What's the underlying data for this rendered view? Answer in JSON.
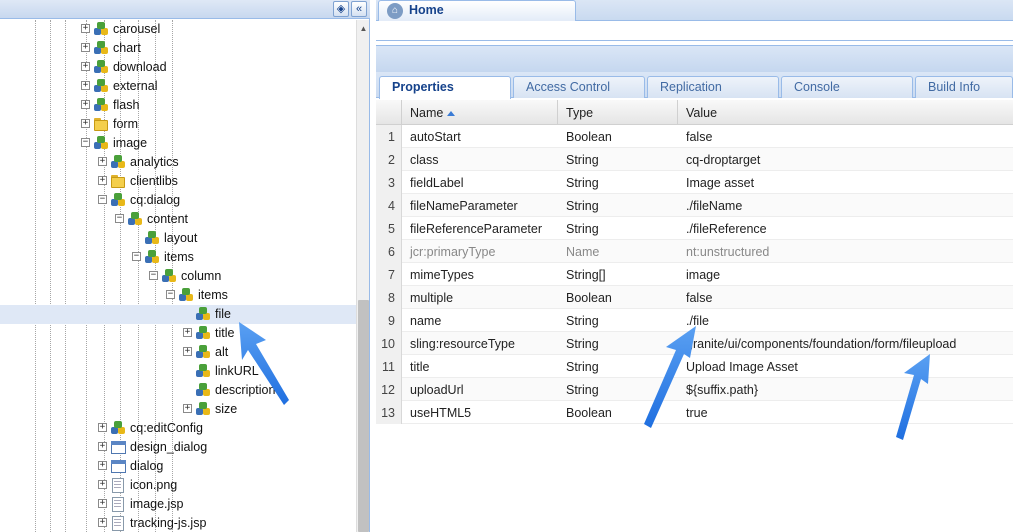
{
  "tree": {
    "toolbar": {
      "binoculars": "binoculars-icon",
      "collapse": "collapse-panel-icon"
    },
    "nodes": [
      {
        "label": "carousel",
        "depth": 0,
        "icon": "node",
        "expander": "plus"
      },
      {
        "label": "chart",
        "depth": 0,
        "icon": "node",
        "expander": "plus"
      },
      {
        "label": "download",
        "depth": 0,
        "icon": "node",
        "expander": "plus"
      },
      {
        "label": "external",
        "depth": 0,
        "icon": "node",
        "expander": "plus"
      },
      {
        "label": "flash",
        "depth": 0,
        "icon": "node",
        "expander": "plus"
      },
      {
        "label": "form",
        "depth": 0,
        "icon": "folder",
        "expander": "plus"
      },
      {
        "label": "image",
        "depth": 0,
        "icon": "node",
        "expander": "minus"
      },
      {
        "label": "analytics",
        "depth": 1,
        "icon": "node",
        "expander": "plus"
      },
      {
        "label": "clientlibs",
        "depth": 1,
        "icon": "folder",
        "expander": "plus"
      },
      {
        "label": "cq:dialog",
        "depth": 1,
        "icon": "node",
        "expander": "minus"
      },
      {
        "label": "content",
        "depth": 2,
        "icon": "node",
        "expander": "minus"
      },
      {
        "label": "layout",
        "depth": 3,
        "icon": "node",
        "expander": "none"
      },
      {
        "label": "items",
        "depth": 3,
        "icon": "node",
        "expander": "minus"
      },
      {
        "label": "column",
        "depth": 4,
        "icon": "node",
        "expander": "minus"
      },
      {
        "label": "items",
        "depth": 5,
        "icon": "node",
        "expander": "minus"
      },
      {
        "label": "file",
        "depth": 6,
        "icon": "node",
        "expander": "none",
        "selected": true
      },
      {
        "label": "title",
        "depth": 6,
        "icon": "node",
        "expander": "plus"
      },
      {
        "label": "alt",
        "depth": 6,
        "icon": "node",
        "expander": "plus"
      },
      {
        "label": "linkURL",
        "depth": 6,
        "icon": "node",
        "expander": "none"
      },
      {
        "label": "description",
        "depth": 6,
        "icon": "node",
        "expander": "none"
      },
      {
        "label": "size",
        "depth": 6,
        "icon": "node",
        "expander": "plus"
      },
      {
        "label": "cq:editConfig",
        "depth": 1,
        "icon": "node",
        "expander": "plus"
      },
      {
        "label": "design_dialog",
        "depth": 1,
        "icon": "dialog",
        "expander": "plus"
      },
      {
        "label": "dialog",
        "depth": 1,
        "icon": "dialog",
        "expander": "plus"
      },
      {
        "label": "icon.png",
        "depth": 1,
        "icon": "file",
        "expander": "plus"
      },
      {
        "label": "image.jsp",
        "depth": 1,
        "icon": "file",
        "expander": "plus"
      },
      {
        "label": "tracking-js.jsp",
        "depth": 1,
        "icon": "file",
        "expander": "plus"
      }
    ]
  },
  "home_tab": {
    "label": "Home"
  },
  "property_tabs": [
    {
      "label": "Properties",
      "active": true
    },
    {
      "label": "Access Control"
    },
    {
      "label": "Replication"
    },
    {
      "label": "Console"
    },
    {
      "label": "Build Info"
    }
  ],
  "grid": {
    "columns": [
      "Name",
      "Type",
      "Value"
    ],
    "sorted_column": "Name",
    "rows": [
      {
        "n": "1",
        "name": "autoStart",
        "type": "Boolean",
        "value": "false"
      },
      {
        "n": "2",
        "name": "class",
        "type": "String",
        "value": "cq-droptarget"
      },
      {
        "n": "3",
        "name": "fieldLabel",
        "type": "String",
        "value": "Image asset"
      },
      {
        "n": "4",
        "name": "fileNameParameter",
        "type": "String",
        "value": "./fileName"
      },
      {
        "n": "5",
        "name": "fileReferenceParameter",
        "type": "String",
        "value": "./fileReference"
      },
      {
        "n": "6",
        "name": "jcr:primaryType",
        "type": "Name",
        "value": "nt:unstructured",
        "muted": true
      },
      {
        "n": "7",
        "name": "mimeTypes",
        "type": "String[]",
        "value": "image"
      },
      {
        "n": "8",
        "name": "multiple",
        "type": "Boolean",
        "value": "false"
      },
      {
        "n": "9",
        "name": "name",
        "type": "String",
        "value": "./file"
      },
      {
        "n": "10",
        "name": "sling:resourceType",
        "type": "String",
        "value": "granite/ui/components/foundation/form/fileupload"
      },
      {
        "n": "11",
        "name": "title",
        "type": "String",
        "value": "Upload Image Asset"
      },
      {
        "n": "12",
        "name": "uploadUrl",
        "type": "String",
        "value": "${suffix.path}"
      },
      {
        "n": "13",
        "name": "useHTML5",
        "type": "Boolean",
        "value": "true"
      }
    ]
  },
  "colors": {
    "accent": "#15428b",
    "annotation_arrow": "#2f80ed",
    "selection": "#dfe8f6"
  }
}
